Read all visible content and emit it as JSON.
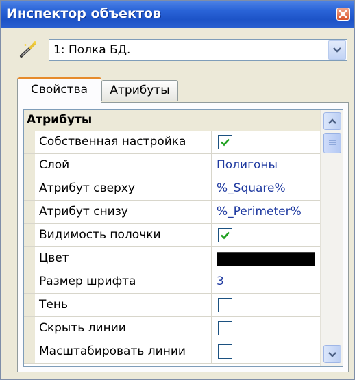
{
  "window": {
    "title": "Инспектор объектов"
  },
  "object_selector": {
    "value": "1: Полка БД."
  },
  "tabs": [
    {
      "label": "Свойства",
      "active": true
    },
    {
      "label": "Атрибуты",
      "active": false
    }
  ],
  "grid": {
    "group_title": "Атрибуты",
    "rows": [
      {
        "name": "Собственная настройка",
        "type": "checkbox",
        "checked": true
      },
      {
        "name": "Слой",
        "type": "text",
        "value": "Полигоны"
      },
      {
        "name": "Атрибут сверху",
        "type": "text",
        "value": "%_Square%"
      },
      {
        "name": "Атрибут снизу",
        "type": "text",
        "value": "%_Perimeter%"
      },
      {
        "name": "Видимость полочки",
        "type": "checkbox",
        "checked": true
      },
      {
        "name": "Цвет",
        "type": "color",
        "value": "#000000"
      },
      {
        "name": "Размер шрифта",
        "type": "text",
        "value": "3"
      },
      {
        "name": "Тень",
        "type": "checkbox",
        "checked": false
      },
      {
        "name": "Скрыть линии",
        "type": "checkbox",
        "checked": false
      },
      {
        "name": "Масштабировать линии",
        "type": "checkbox",
        "checked": false
      }
    ]
  },
  "colors": {
    "titlebar": "#1d53c7",
    "active_tab_accent": "#e68b2c",
    "value_text": "#1f3aa0",
    "checkmark": "#21a121"
  },
  "icons": {
    "object": "magic-wand-icon",
    "close": "close-icon",
    "dropdown": "chevron-down-icon",
    "scroll_up": "chevron-up-icon",
    "scroll_down": "chevron-down-icon"
  }
}
